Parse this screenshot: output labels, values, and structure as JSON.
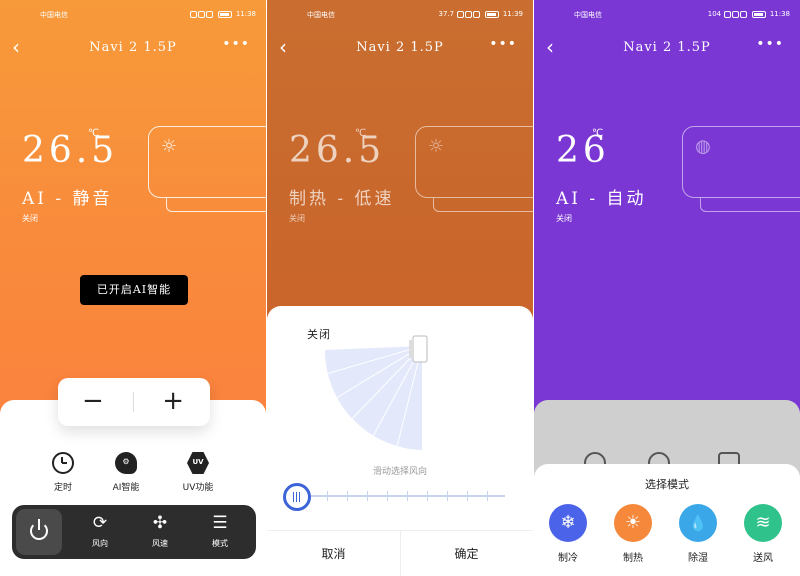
{
  "colors": {
    "panel1_accent": "#f98a3c",
    "panel2_accent": "#c9672c",
    "panel3_accent": "#7b37d4",
    "slider_blue": "#3d63d8",
    "mode_cool": "#4b63e8",
    "mode_heat": "#f5883a",
    "mode_dry": "#3aa7e8",
    "mode_fan": "#2fc28a"
  },
  "screens": [
    {
      "status": {
        "carrier": "中国电信",
        "speed": "",
        "time": "11:38"
      },
      "title": "Navi 2 1.5P",
      "temp": "26.5",
      "unit": "℃",
      "mode": "AI - 静音",
      "sub": "关闭",
      "ai_pill": "已开启AI智能",
      "stepper": {
        "minus": "−",
        "plus": "+"
      },
      "functions": [
        {
          "label": "定时",
          "icon": "clock-icon"
        },
        {
          "label": "AI智能",
          "icon": "ai-head-icon"
        },
        {
          "label": "UV功能",
          "icon": "uv-icon",
          "icon_text": "UV"
        }
      ],
      "dock": [
        {
          "label": "风向",
          "icon": "swing-icon",
          "glyph": "⟳"
        },
        {
          "label": "风速",
          "icon": "fan-icon",
          "glyph": "✣"
        },
        {
          "label": "模式",
          "icon": "menu-icon",
          "glyph": "☰"
        }
      ]
    },
    {
      "status": {
        "carrier": "中国电信",
        "speed": "37.7",
        "time": "11:39"
      },
      "title": "Navi 2 1.5P",
      "temp": "26.5",
      "unit": "℃",
      "mode": "制热 - 低速",
      "sub": "关闭",
      "sheet": {
        "off_label": "关闭",
        "hint": "滑动选择风向",
        "cancel": "取消",
        "confirm": "确定",
        "slider_position": 0
      }
    },
    {
      "status": {
        "carrier": "中国电信",
        "speed": "104",
        "time": "11:38"
      },
      "title": "Navi 2 1.5P",
      "temp": "26",
      "unit": "℃",
      "mode": "AI - 自动",
      "sub": "关闭",
      "sheet": {
        "title": "选择模式",
        "modes": [
          {
            "label": "制冷",
            "icon": "snowflake-icon",
            "glyph": "❄"
          },
          {
            "label": "制热",
            "icon": "sun-icon",
            "glyph": "☀"
          },
          {
            "label": "除湿",
            "icon": "droplet-icon",
            "glyph": "💧"
          },
          {
            "label": "送风",
            "icon": "wind-icon",
            "glyph": "≋"
          }
        ]
      }
    }
  ]
}
